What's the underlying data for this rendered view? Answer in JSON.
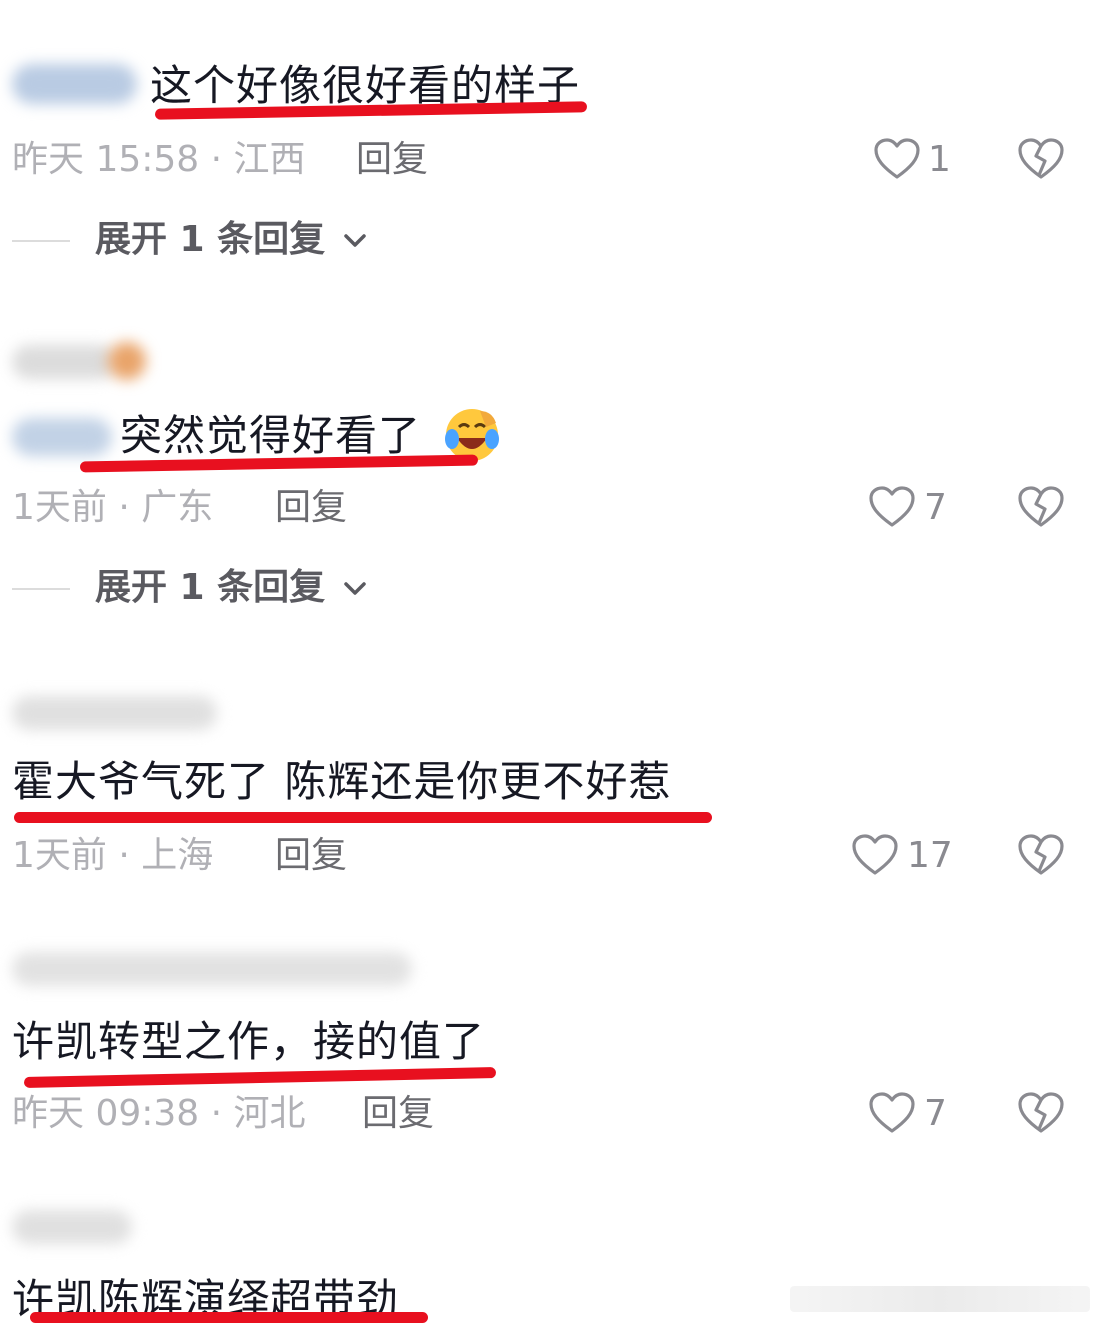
{
  "comments": [
    {
      "text": "这个好像很好看的样子",
      "time_loc": "昨天 15:58 · 江西",
      "reply": "回复",
      "likes": "1",
      "expand": "展开 1 条回复"
    },
    {
      "text": "突然觉得好看了",
      "time_loc": "1天前 · 广东",
      "reply": "回复",
      "likes": "7",
      "expand": "展开 1 条回复"
    },
    {
      "text": "霍大爷气死了 陈辉还是你更不好惹",
      "time_loc": "1天前 · 上海",
      "reply": "回复",
      "likes": "17"
    },
    {
      "text": "许凯转型之作，接的值了",
      "time_loc": "昨天 09:38 · 河北",
      "reply": "回复",
      "likes": "7"
    },
    {
      "text": "许凯陈辉演绎超带劲"
    }
  ],
  "colors": {
    "underline": "#e8101f",
    "meta": "#b0b0b5",
    "reply": "#6b6b70"
  },
  "icons": [
    "heart-outline-icon",
    "broken-heart-icon",
    "chevron-down-icon",
    "laughing-crying-emoji"
  ]
}
